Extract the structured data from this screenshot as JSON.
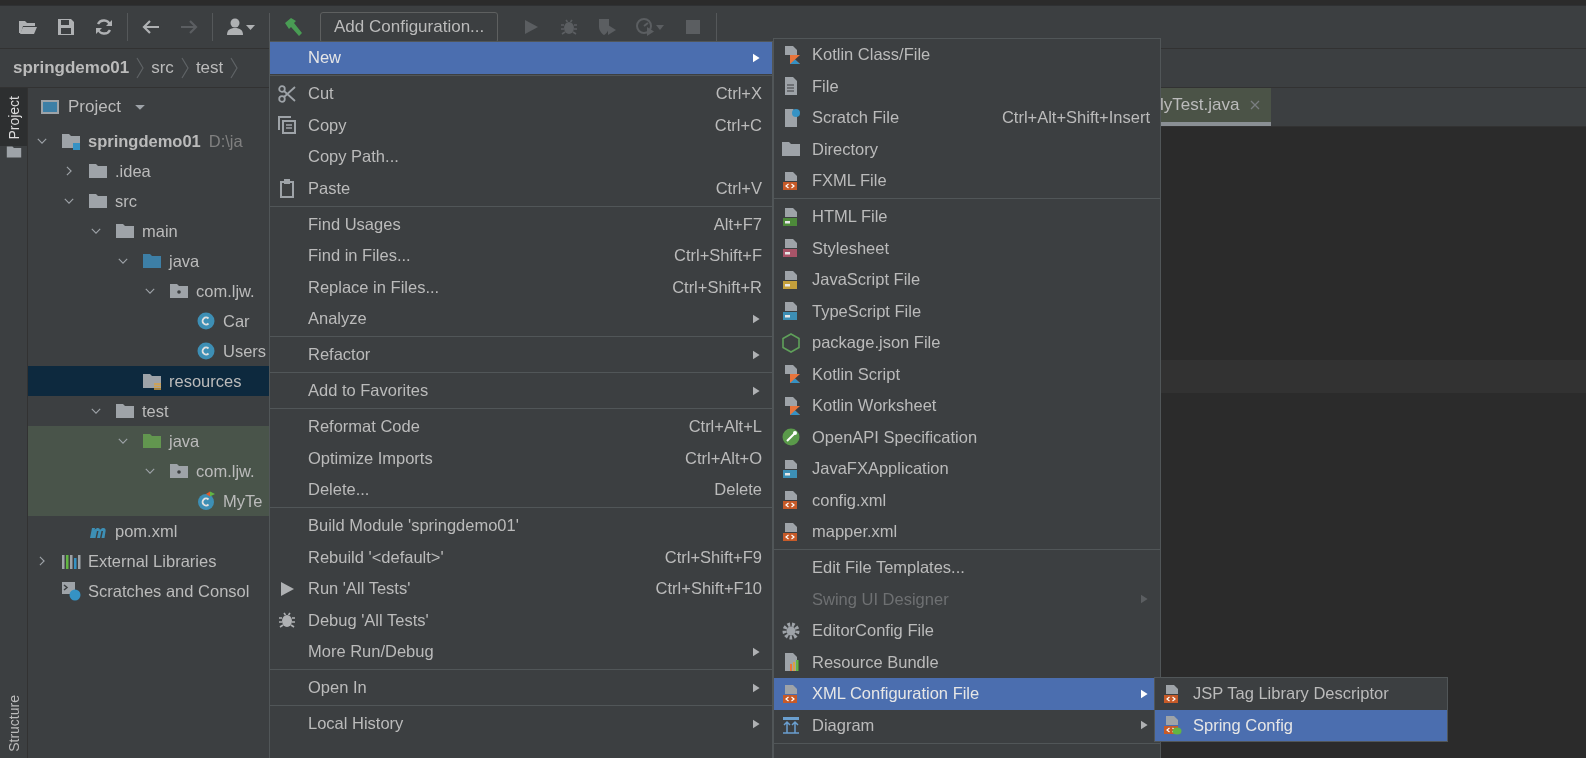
{
  "toolbar": [
    {
      "kind": "open",
      "disabled": false
    },
    {
      "kind": "save",
      "disabled": false
    },
    {
      "kind": "sync",
      "disabled": false
    },
    {
      "kind": "separator"
    },
    {
      "kind": "back",
      "disabled": false
    },
    {
      "kind": "forward",
      "disabled": true
    },
    {
      "kind": "separator"
    },
    {
      "kind": "user",
      "disabled": false
    },
    {
      "kind": "separator"
    },
    {
      "kind": "build",
      "disabled": false
    },
    {
      "kind": "config",
      "label": "Add Configuration..."
    },
    {
      "kind": "run",
      "disabled": true
    },
    {
      "kind": "debug",
      "disabled": true
    },
    {
      "kind": "coverage",
      "disabled": true
    },
    {
      "kind": "profile",
      "disabled": true
    },
    {
      "kind": "stop",
      "disabled": true
    },
    {
      "kind": "separator"
    }
  ],
  "breadcrumbs": [
    "springdemo01",
    "src",
    "test"
  ],
  "tool_window_bar": {
    "top": [
      {
        "label": "Project",
        "selected": true
      }
    ],
    "bottom": [
      {
        "label": "Structure",
        "selected": false
      }
    ]
  },
  "project_panel": {
    "title": "Project",
    "tree": [
      {
        "kind": "module",
        "label": "springdemo01",
        "detail": "D:\\ja",
        "expanded": true,
        "selected": false,
        "test_scope": false,
        "children": [
          {
            "kind": "folder",
            "label": ".idea",
            "expanded": false,
            "selected": false,
            "test_scope": false
          },
          {
            "kind": "folder",
            "label": "src",
            "expanded": true,
            "selected": false,
            "test_scope": false,
            "children": [
              {
                "kind": "folder",
                "label": "main",
                "expanded": true,
                "selected": false,
                "test_scope": false,
                "children": [
                  {
                    "kind": "source-folder",
                    "label": "java",
                    "expanded": true,
                    "selected": false,
                    "test_scope": false,
                    "children": [
                      {
                        "kind": "package",
                        "label": "com.ljw.",
                        "expanded": true,
                        "selected": false,
                        "test_scope": false,
                        "children": [
                          {
                            "kind": "class",
                            "label": "Car",
                            "selected": false,
                            "test_scope": false
                          },
                          {
                            "kind": "class",
                            "label": "Users",
                            "selected": false,
                            "test_scope": false
                          }
                        ]
                      }
                    ]
                  },
                  {
                    "kind": "resources-folder",
                    "label": "resources",
                    "selected": true,
                    "test_scope": false
                  }
                ]
              },
              {
                "kind": "folder",
                "label": "test",
                "expanded": true,
                "selected": false,
                "test_scope": false,
                "children": [
                  {
                    "kind": "test-folder",
                    "label": "java",
                    "expanded": true,
                    "selected": false,
                    "test_scope": true,
                    "children": [
                      {
                        "kind": "package",
                        "label": "com.ljw.",
                        "expanded": true,
                        "selected": false,
                        "test_scope": true,
                        "children": [
                          {
                            "kind": "test-class",
                            "label": "MyTe",
                            "selected": false,
                            "test_scope": true
                          }
                        ]
                      }
                    ]
                  }
                ]
              }
            ]
          },
          {
            "kind": "maven",
            "label": "pom.xml",
            "selected": false,
            "test_scope": false
          }
        ]
      },
      {
        "kind": "libraries",
        "label": "External Libraries",
        "expanded": false,
        "selected": false,
        "test_scope": false
      },
      {
        "kind": "scratches",
        "label": "Scratches and Consol",
        "selected": false,
        "test_scope": false
      }
    ]
  },
  "editor": {
    "tabs": [
      {
        "label": "lyTest.java",
        "selected": true
      }
    ]
  },
  "context_menu": {
    "items": [
      {
        "kind": "item",
        "label": "New",
        "submenu": true,
        "selected": true
      },
      {
        "kind": "separator"
      },
      {
        "kind": "item",
        "label": "Cut",
        "shortcut": "Ctrl+X",
        "submenu": false,
        "selected": false
      },
      {
        "kind": "item",
        "label": "Copy",
        "shortcut": "Ctrl+C",
        "submenu": false,
        "selected": false
      },
      {
        "kind": "item",
        "label": "Copy Path...",
        "submenu": false,
        "selected": false
      },
      {
        "kind": "item",
        "label": "Paste",
        "shortcut": "Ctrl+V",
        "submenu": false,
        "selected": false
      },
      {
        "kind": "separator"
      },
      {
        "kind": "item",
        "label": "Find Usages",
        "shortcut": "Alt+F7",
        "submenu": false,
        "selected": false
      },
      {
        "kind": "item",
        "label": "Find in Files...",
        "shortcut": "Ctrl+Shift+F",
        "submenu": false,
        "selected": false
      },
      {
        "kind": "item",
        "label": "Replace in Files...",
        "shortcut": "Ctrl+Shift+R",
        "submenu": false,
        "selected": false
      },
      {
        "kind": "item",
        "label": "Analyze",
        "submenu": true,
        "selected": false
      },
      {
        "kind": "separator"
      },
      {
        "kind": "item",
        "label": "Refactor",
        "submenu": true,
        "selected": false
      },
      {
        "kind": "separator"
      },
      {
        "kind": "item",
        "label": "Add to Favorites",
        "submenu": true,
        "selected": false
      },
      {
        "kind": "separator"
      },
      {
        "kind": "item",
        "label": "Reformat Code",
        "shortcut": "Ctrl+Alt+L",
        "submenu": false,
        "selected": false
      },
      {
        "kind": "item",
        "label": "Optimize Imports",
        "shortcut": "Ctrl+Alt+O",
        "submenu": false,
        "selected": false
      },
      {
        "kind": "item",
        "label": "Delete...",
        "shortcut": "Delete",
        "submenu": false,
        "selected": false
      },
      {
        "kind": "separator"
      },
      {
        "kind": "item",
        "label": "Build Module 'springdemo01'",
        "submenu": false,
        "selected": false
      },
      {
        "kind": "item",
        "label": "Rebuild '<default>'",
        "shortcut": "Ctrl+Shift+F9",
        "submenu": false,
        "selected": false
      },
      {
        "kind": "item",
        "label": "Run 'All Tests'",
        "shortcut": "Ctrl+Shift+F10",
        "submenu": false,
        "selected": false
      },
      {
        "kind": "item",
        "label": "Debug 'All Tests'",
        "submenu": false,
        "selected": false
      },
      {
        "kind": "item",
        "label": "More Run/Debug",
        "submenu": true,
        "selected": false
      },
      {
        "kind": "separator"
      },
      {
        "kind": "item",
        "label": "Open In",
        "submenu": true,
        "selected": false
      },
      {
        "kind": "separator"
      },
      {
        "kind": "item",
        "label": "Local History",
        "submenu": true,
        "selected": false
      }
    ]
  },
  "new_submenu": {
    "items": [
      {
        "kind": "item",
        "label": "Kotlin Class/File",
        "submenu": false,
        "selected": false,
        "disabled": false
      },
      {
        "kind": "item",
        "label": "File",
        "submenu": false,
        "selected": false,
        "disabled": false
      },
      {
        "kind": "item",
        "label": "Scratch File",
        "shortcut": "Ctrl+Alt+Shift+Insert",
        "submenu": false,
        "selected": false,
        "disabled": false
      },
      {
        "kind": "item",
        "label": "Directory",
        "submenu": false,
        "selected": false,
        "disabled": false
      },
      {
        "kind": "item",
        "label": "FXML File",
        "submenu": false,
        "selected": false,
        "disabled": false
      },
      {
        "kind": "separator"
      },
      {
        "kind": "item",
        "label": "HTML File",
        "submenu": false,
        "selected": false,
        "disabled": false
      },
      {
        "kind": "item",
        "label": "Stylesheet",
        "submenu": false,
        "selected": false,
        "disabled": false
      },
      {
        "kind": "item",
        "label": "JavaScript File",
        "submenu": false,
        "selected": false,
        "disabled": false
      },
      {
        "kind": "item",
        "label": "TypeScript File",
        "submenu": false,
        "selected": false,
        "disabled": false
      },
      {
        "kind": "item",
        "label": "package.json File",
        "submenu": false,
        "selected": false,
        "disabled": false
      },
      {
        "kind": "item",
        "label": "Kotlin Script",
        "submenu": false,
        "selected": false,
        "disabled": false
      },
      {
        "kind": "item",
        "label": "Kotlin Worksheet",
        "submenu": false,
        "selected": false,
        "disabled": false
      },
      {
        "kind": "item",
        "label": "OpenAPI Specification",
        "submenu": false,
        "selected": false,
        "disabled": false
      },
      {
        "kind": "item",
        "label": "JavaFXApplication",
        "submenu": false,
        "selected": false,
        "disabled": false
      },
      {
        "kind": "item",
        "label": "config.xml",
        "submenu": false,
        "selected": false,
        "disabled": false
      },
      {
        "kind": "item",
        "label": "mapper.xml",
        "submenu": false,
        "selected": false,
        "disabled": false
      },
      {
        "kind": "separator"
      },
      {
        "kind": "item",
        "label": "Edit File Templates...",
        "submenu": false,
        "selected": false,
        "disabled": false
      },
      {
        "kind": "item",
        "label": "Swing UI Designer",
        "submenu": true,
        "selected": false,
        "disabled": true
      },
      {
        "kind": "item",
        "label": "EditorConfig File",
        "submenu": false,
        "selected": false,
        "disabled": false
      },
      {
        "kind": "item",
        "label": "Resource Bundle",
        "submenu": false,
        "selected": false,
        "disabled": false
      },
      {
        "kind": "item",
        "label": "XML Configuration File",
        "submenu": true,
        "selected": true,
        "disabled": false
      },
      {
        "kind": "item",
        "label": "Diagram",
        "submenu": true,
        "selected": false,
        "disabled": false
      },
      {
        "kind": "separator"
      }
    ]
  },
  "xml_submenu": {
    "items": [
      {
        "kind": "item",
        "label": "JSP Tag Library Descriptor",
        "submenu": false,
        "selected": false,
        "disabled": false
      },
      {
        "kind": "item",
        "label": "Spring Config",
        "submenu": false,
        "selected": true,
        "disabled": false
      }
    ]
  }
}
